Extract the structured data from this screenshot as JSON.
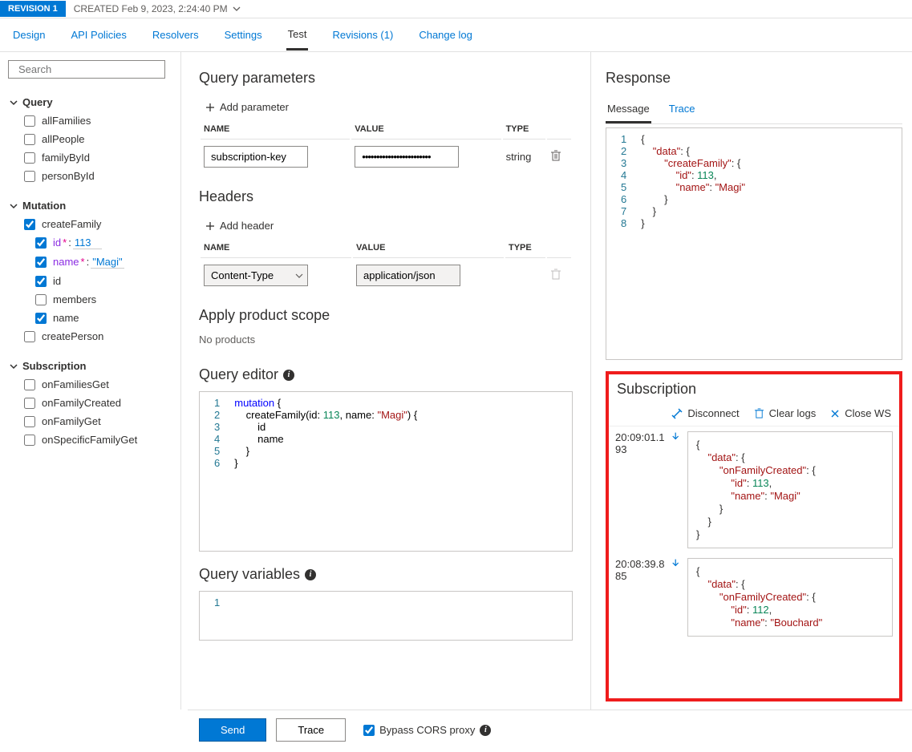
{
  "revision": {
    "badge": "REVISION 1",
    "created": "CREATED Feb 9, 2023, 2:24:40 PM"
  },
  "tabs": [
    "Design",
    "API Policies",
    "Resolvers",
    "Settings",
    "Test",
    "Revisions (1)",
    "Change log"
  ],
  "active_tab": "Test",
  "search": {
    "placeholder": "Search"
  },
  "tree": {
    "query": {
      "label": "Query",
      "items": [
        "allFamilies",
        "allPeople",
        "familyById",
        "personById"
      ]
    },
    "mutation": {
      "label": "Mutation",
      "createFamily": {
        "label": "createFamily",
        "params": [
          {
            "name": "id",
            "required": "*",
            "value": "113"
          },
          {
            "name": "name",
            "required": "*",
            "value": "\"Magi\""
          }
        ],
        "fields": [
          "id",
          "members",
          "name"
        ]
      },
      "createPerson": {
        "label": "createPerson"
      }
    },
    "subscription": {
      "label": "Subscription",
      "items": [
        "onFamiliesGet",
        "onFamilyCreated",
        "onFamilyGet",
        "onSpecificFamilyGet"
      ]
    }
  },
  "center": {
    "query_params": {
      "title": "Query parameters",
      "add": "Add parameter",
      "col_name": "NAME",
      "col_value": "VALUE",
      "col_type": "TYPE",
      "rows": [
        {
          "name": "subscription-key",
          "value": "••••••••••••••••••••••••",
          "type": "string"
        }
      ]
    },
    "headers": {
      "title": "Headers",
      "add": "Add header",
      "col_name": "NAME",
      "col_value": "VALUE",
      "col_type": "TYPE",
      "rows": [
        {
          "name": "Content-Type",
          "value": "application/json",
          "type": ""
        }
      ]
    },
    "scope": {
      "title": "Apply product scope",
      "none": "No products"
    },
    "editor": {
      "title": "Query editor",
      "lines": [
        "1",
        "2",
        "3",
        "4",
        "5",
        "6"
      ],
      "code": {
        "l1a": "mutation",
        "l1b": " {",
        "l2a": "    createFamily(id: ",
        "l2b": "113",
        "l2c": ", name: ",
        "l2d": "\"Magi\"",
        "l2e": ") {",
        "l3": "        id",
        "l4": "        name",
        "l5": "    }",
        "l6": "}"
      }
    },
    "variables": {
      "title": "Query variables",
      "lines": [
        "1"
      ]
    }
  },
  "response": {
    "title": "Response",
    "tabs": [
      "Message",
      "Trace"
    ],
    "active": "Message",
    "lines": [
      "1",
      "2",
      "3",
      "4",
      "5",
      "6",
      "7",
      "8"
    ],
    "json_txt": {
      "l1": "{",
      "l2a": "    ",
      "l2b": "\"data\"",
      "l2c": ": {",
      "l3a": "        ",
      "l3b": "\"createFamily\"",
      "l3c": ": {",
      "l4a": "            ",
      "l4b": "\"id\"",
      "l4c": ": ",
      "l4d": "113",
      "l4e": ",",
      "l5a": "            ",
      "l5b": "\"name\"",
      "l5c": ": ",
      "l5d": "\"Magi\"",
      "l6": "        }",
      "l7": "    }",
      "l8": "}"
    }
  },
  "subscription_panel": {
    "title": "Subscription",
    "actions": {
      "disconnect": "Disconnect",
      "clear": "Clear logs",
      "close": "Close WS"
    },
    "events": [
      {
        "time": "20:09:01.193",
        "txt": {
          "l1": "{",
          "l2a": "    ",
          "l2b": "\"data\"",
          "l2c": ": {",
          "l3a": "        ",
          "l3b": "\"onFamilyCreated\"",
          "l3c": ": {",
          "l4a": "            ",
          "l4b": "\"id\"",
          "l4c": ": ",
          "l4d": "113",
          "l4e": ",",
          "l5a": "            ",
          "l5b": "\"name\"",
          "l5c": ": ",
          "l5d": "\"Magi\"",
          "l6": "        }",
          "l7": "    }",
          "l8": "}"
        }
      },
      {
        "time": "20:08:39.885",
        "txt": {
          "l1": "{",
          "l2a": "    ",
          "l2b": "\"data\"",
          "l2c": ": {",
          "l3a": "        ",
          "l3b": "\"onFamilyCreated\"",
          "l3c": ": {",
          "l4a": "            ",
          "l4b": "\"id\"",
          "l4c": ": ",
          "l4d": "112",
          "l4e": ",",
          "l5a": "            ",
          "l5b": "\"name\"",
          "l5c": ": ",
          "l5d": "\"Bouchard\""
        }
      }
    ]
  },
  "footer": {
    "send": "Send",
    "trace": "Trace",
    "bypass": "Bypass CORS proxy"
  }
}
